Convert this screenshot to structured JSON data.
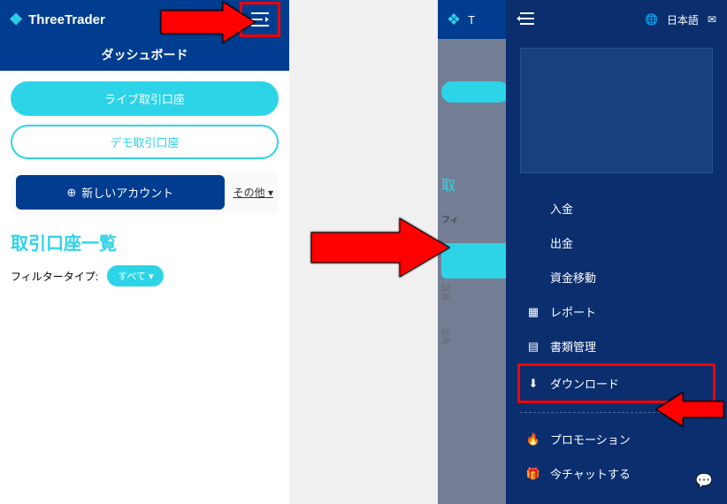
{
  "brand": "ThreeTrader",
  "left": {
    "dashboard": "ダッシュボード",
    "liveAccount": "ライブ取引口座",
    "demoAccount": "デモ取引口座",
    "newAccount": "新しいアカウント",
    "other": "その他",
    "accountsTitle": "取引口座一覧",
    "filterLabel": "フィルタータイプ:",
    "filterAll": "すべて"
  },
  "right": {
    "language": "日本語",
    "menu": {
      "deposit": "入金",
      "withdraw": "出金",
      "transfer": "資金移動",
      "report": "レポート",
      "documents": "書類管理",
      "download": "ダウンロード",
      "promotion": "プロモーション",
      "chat": "今チャットする"
    }
  }
}
